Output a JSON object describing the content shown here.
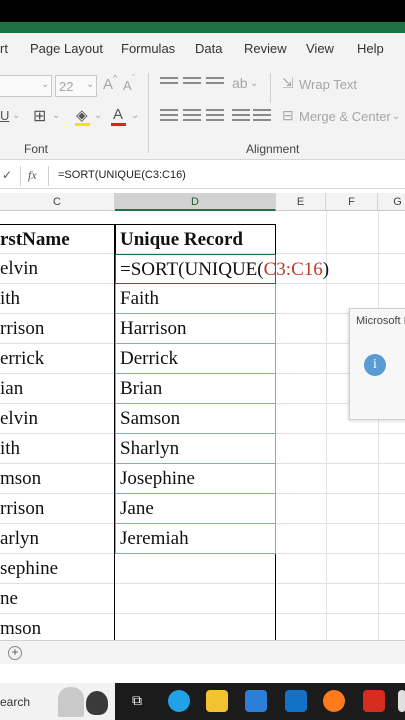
{
  "ribbon_tabs": [
    "rt",
    "Page Layout",
    "Formulas",
    "Data",
    "Review",
    "View",
    "Help"
  ],
  "ribbon": {
    "font_size": "22",
    "grow_font": "A",
    "shrink_font": "A",
    "wrap_text": "Wrap Text",
    "merge_center": "Merge & Center",
    "font_group": "Font",
    "alignment_group": "Alignment",
    "underline": "U"
  },
  "formula_bar": {
    "fx_label": "fx",
    "formula": "=SORT(UNIQUE(C3:C16)"
  },
  "columns": [
    "C",
    "D",
    "E",
    "F",
    "G"
  ],
  "sheet": {
    "header_c": "rstName",
    "header_d": "Unique Record",
    "formula_prefix": "=SORT(UNIQUE(",
    "formula_ref": "C3:C16",
    "formula_suffix": ")",
    "col_c_rows": [
      "elvin",
      "ith",
      "rrison",
      "errick",
      "ian",
      "elvin",
      "ith",
      "mson",
      "rrison",
      "arlyn",
      "sephine",
      "ne",
      "mson"
    ],
    "col_d_rows": [
      "Faith",
      "Harrison",
      "Derrick",
      "Brian",
      "Samson",
      "Sharlyn",
      "Josephine",
      "Jane",
      "Jeremiah"
    ]
  },
  "dialog": {
    "title": "Microsoft I",
    "info_glyph": "i"
  },
  "sheet_bar": {
    "add": "+"
  },
  "taskbar": {
    "search": "earch"
  },
  "colors": {
    "excel_green": "#1e7145",
    "ref_red": "#c0392b",
    "selection_blue": "#7fa7d9"
  }
}
